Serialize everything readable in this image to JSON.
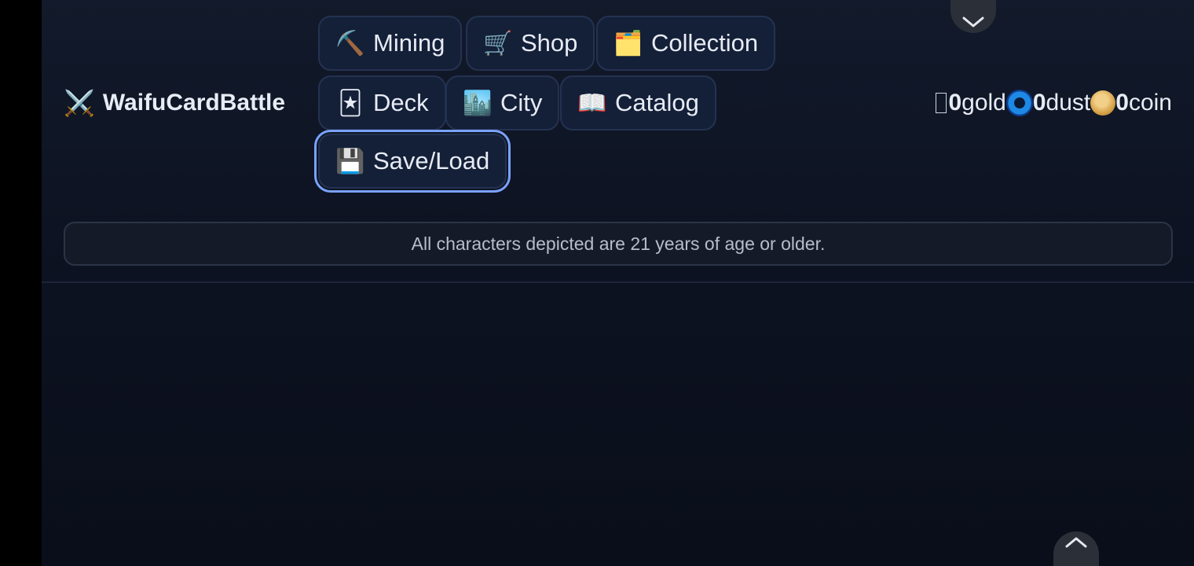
{
  "brand": {
    "icon": "⚔️",
    "title": "WaifuCardBattle"
  },
  "nav": [
    {
      "id": "mining",
      "icon": "⛏️",
      "label": "Mining"
    },
    {
      "id": "shop",
      "icon": "🛒",
      "label": "Shop"
    },
    {
      "id": "collection",
      "icon": "🗂️",
      "label": "Collection"
    },
    {
      "id": "deck",
      "icon": "🃏",
      "label": "Deck"
    },
    {
      "id": "city",
      "icon": "🏙️",
      "label": "City"
    },
    {
      "id": "catalog",
      "icon": "📖",
      "label": "Catalog"
    },
    {
      "id": "saveload",
      "icon": "💾",
      "label": "Save/Load"
    }
  ],
  "currency": {
    "gold": {
      "value": "0",
      "label": "gold",
      "icon": "gold-icon"
    },
    "dust": {
      "value": "0",
      "label": "dust",
      "icon": "dust-icon"
    },
    "coin": {
      "value": "0",
      "label": "coin",
      "icon": "coin-icon"
    }
  },
  "notice": "All characters depicted are 21 years of age or older.",
  "colors": {
    "background": "#0d1322",
    "button_bg": "#142038",
    "button_border": "#243251",
    "focus_ring": "#7aa2ff",
    "text": "#e7ebf4"
  }
}
